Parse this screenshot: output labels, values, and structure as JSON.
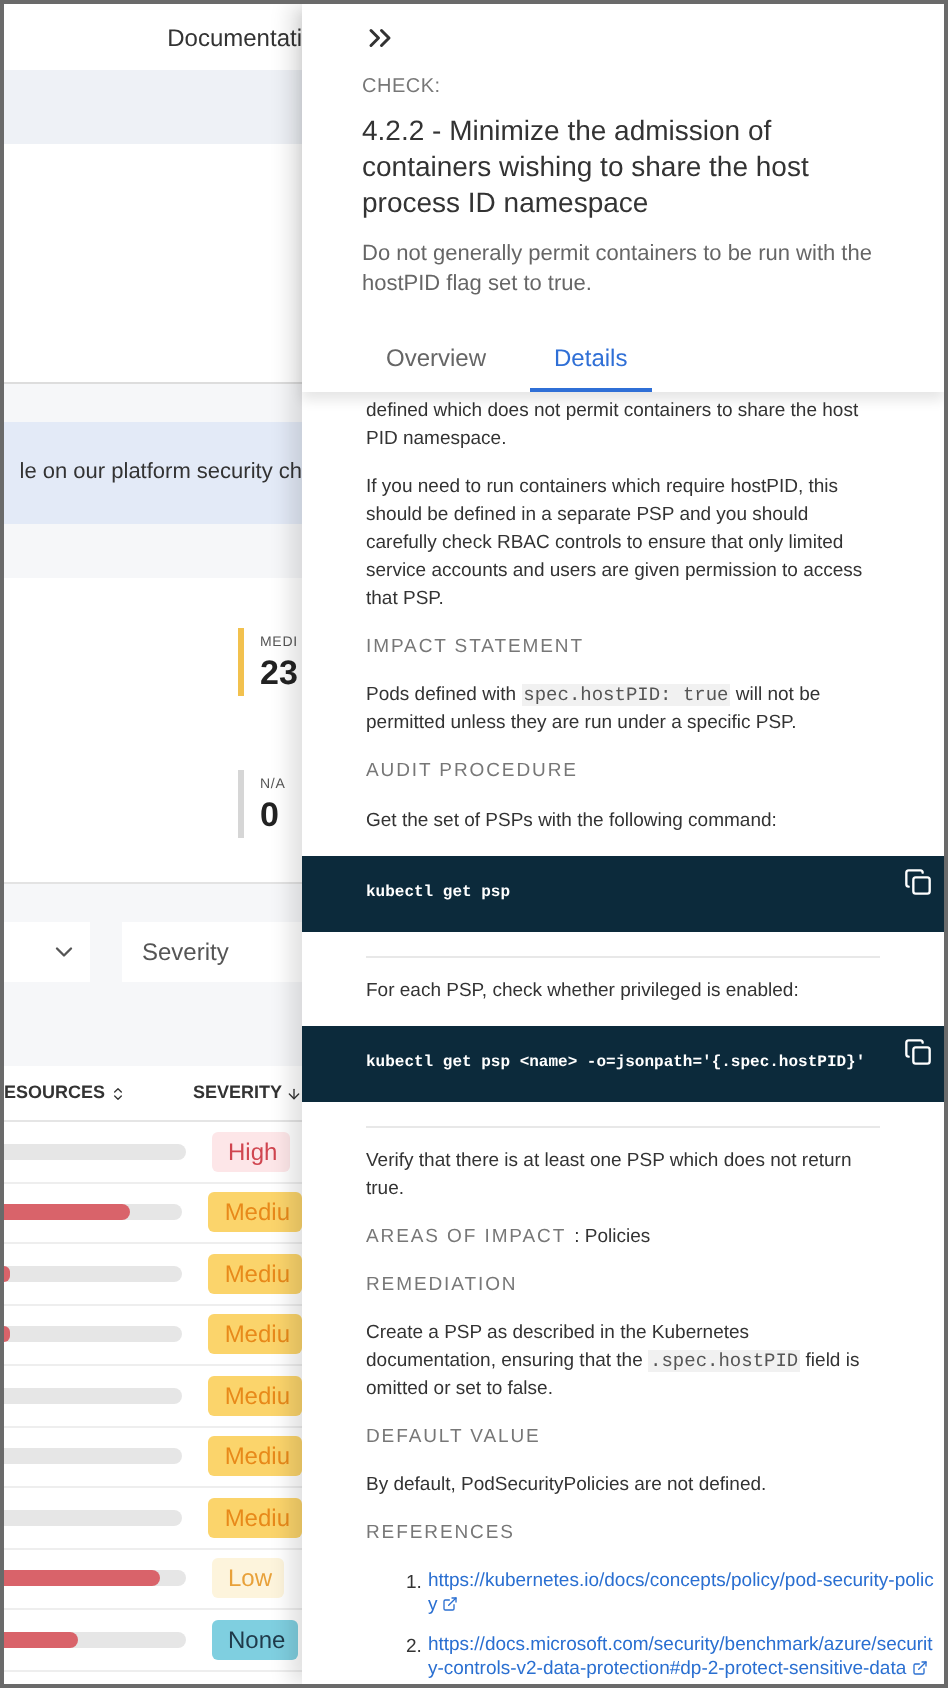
{
  "background": {
    "header_link": "Documentati",
    "banner": "le on our platform security ch",
    "stats": [
      {
        "label": "MEDI",
        "value": "23",
        "color": "#f2c14e"
      },
      {
        "label": "N/A",
        "value": "0",
        "color": "#d6d6d6"
      }
    ],
    "severity_filter": {
      "placeholder": "Severity"
    },
    "table": {
      "columns": [
        "ESOURCES",
        "SEVERITY"
      ],
      "rows": [
        {
          "severity": "High",
          "kind": "high"
        },
        {
          "level": 0.71,
          "severity": "Mediu",
          "kind": "medium"
        },
        {
          "level": 0.03,
          "severity": "Mediu",
          "kind": "medium"
        },
        {
          "level": 0.03,
          "severity": "Mediu",
          "kind": "medium"
        },
        {
          "severity": "Mediu",
          "kind": "medium"
        },
        {
          "severity": "Mediu",
          "kind": "medium"
        },
        {
          "severity": "Mediu",
          "kind": "medium"
        },
        {
          "level": 0.86,
          "severity": "Low",
          "kind": "low"
        },
        {
          "level": 0.41,
          "severity": "None",
          "kind": "none"
        }
      ]
    }
  },
  "drawer": {
    "label": "CHECK:",
    "title": "4.2.2 - Minimize the admission of containers wishing to share the host process ID namespace",
    "description": "Do not generally permit containers to be run with the hostPID flag set to true.",
    "tabs": [
      {
        "label": "Overview",
        "selected": false
      },
      {
        "label": "Details",
        "selected": true
      }
    ],
    "blocks": [
      {
        "kind": "paragraph",
        "segments": [
          {
            "kind": "text",
            "text": "defined which does not permit containers to share the host PID namespace."
          }
        ]
      },
      {
        "kind": "paragraph",
        "segments": [
          {
            "kind": "text",
            "text": "If you need to run containers which require hostPID, this should be defined in a separate PSP and you should carefully check RBAC controls to ensure that only limited service accounts and users are given permission to access that PSP."
          }
        ]
      },
      {
        "kind": "heading",
        "text": "IMPACT STATEMENT"
      },
      {
        "kind": "paragraph",
        "segments": [
          {
            "kind": "text",
            "text": "Pods defined with "
          },
          {
            "kind": "code",
            "text": "spec.hostPID: true"
          },
          {
            "kind": "text",
            "text": " will not be permitted unless they are run under a specific PSP."
          }
        ]
      },
      {
        "kind": "heading",
        "text": "AUDIT PROCEDURE"
      },
      {
        "kind": "paragraph",
        "segments": [
          {
            "kind": "text",
            "text": "Get the set of PSPs with the following command:"
          }
        ]
      },
      {
        "kind": "code",
        "text": "kubectl get psp"
      },
      {
        "kind": "paragraph",
        "segments": [
          {
            "kind": "text",
            "text": "For each PSP, check whether privileged is enabled:"
          }
        ]
      },
      {
        "kind": "code",
        "text": "kubectl get psp <name> -o=jsonpath='{.spec.hostPID}'"
      },
      {
        "kind": "paragraph",
        "segments": [
          {
            "kind": "text",
            "text": "Verify that there is at least one PSP which does not return true."
          }
        ]
      },
      {
        "kind": "field",
        "label": "AREAS OF IMPACT",
        "value": ": Policies"
      },
      {
        "kind": "heading",
        "text": "REMEDIATION"
      },
      {
        "kind": "paragraph",
        "segments": [
          {
            "kind": "text",
            "text": "Create a PSP as described in the Kubernetes documentation, ensuring that the "
          },
          {
            "kind": "code",
            "text": ".spec.hostPID"
          },
          {
            "kind": "text",
            "text": " field is omitted or set to false."
          }
        ]
      },
      {
        "kind": "heading",
        "text": "DEFAULT VALUE"
      },
      {
        "kind": "paragraph",
        "segments": [
          {
            "kind": "text",
            "text": "By default, PodSecurityPolicies are not defined."
          }
        ]
      },
      {
        "kind": "heading",
        "text": "REFERENCES"
      },
      {
        "kind": "references",
        "items": [
          {
            "number": "1.",
            "url": "https://kubernetes.io/docs/concepts/policy/pod-security-policy"
          },
          {
            "number": "2.",
            "url": "https://docs.microsoft.com/security/benchmark/azure/security-controls-v2-data-protection#dp-2-protect-sensitive-data"
          }
        ]
      }
    ]
  }
}
